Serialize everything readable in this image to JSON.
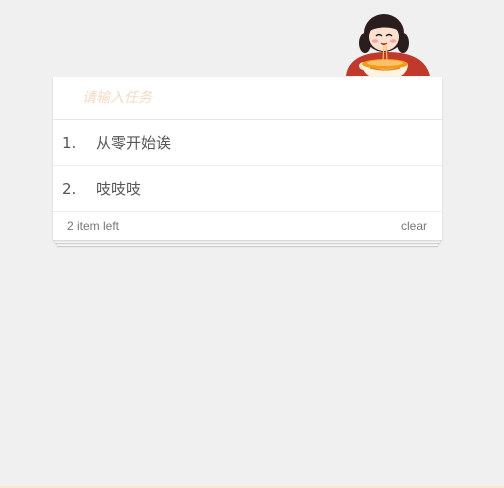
{
  "header": {
    "mascot_icon": "girl-eating-noodles-icon"
  },
  "input": {
    "placeholder": "请输入任务",
    "value": ""
  },
  "todos": [
    {
      "index": "1.",
      "text": "从零开始诶"
    },
    {
      "index": "2.",
      "text": "吱吱吱"
    }
  ],
  "footer": {
    "items_left": "2 item left",
    "clear_label": "clear"
  },
  "colors": {
    "background": "#f0f0f0",
    "card": "#ffffff",
    "placeholder": "#f0dcc4",
    "text": "#555555",
    "mascot_shirt": "#c0392b",
    "mascot_bowl": "#f39c12"
  }
}
